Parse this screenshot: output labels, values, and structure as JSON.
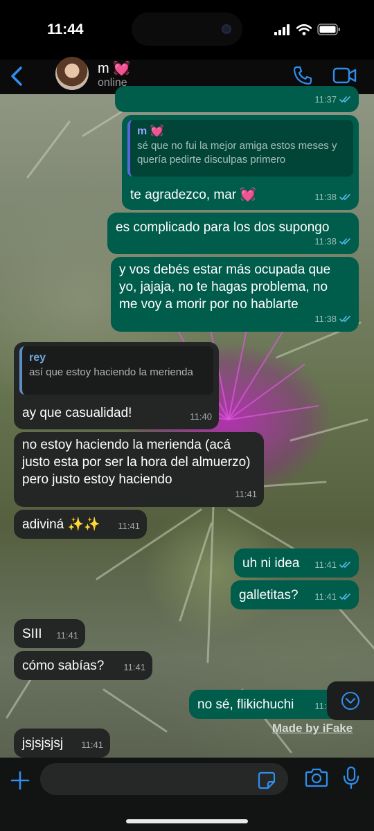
{
  "status_bar": {
    "time": "11:44"
  },
  "header": {
    "contact_name": "m 💓",
    "contact_status": "online"
  },
  "messages": [
    {
      "id": "m0",
      "direction": "out",
      "text": "",
      "time": "11:37",
      "read": true
    },
    {
      "id": "m1",
      "direction": "out",
      "reply_author": "m 💓",
      "reply_text": "sé que no fui la mejor amiga estos meses y quería pedirte disculpas primero",
      "text": "te agradezco, mar 💓",
      "time": "11:38",
      "read": true
    },
    {
      "id": "m2",
      "direction": "out",
      "text": "es complicado para los dos supongo",
      "time": "11:38",
      "read": true
    },
    {
      "id": "m3",
      "direction": "out",
      "text": "y vos debés estar más ocupada que yo, jajaja, no te hagas problema, no me voy a morir por no hablarte",
      "time": "11:38",
      "read": true
    },
    {
      "id": "m4",
      "direction": "in",
      "reply_author": "rey",
      "reply_text": "así que estoy haciendo la merienda",
      "text": "ay que casualidad!",
      "time": "11:40"
    },
    {
      "id": "m5",
      "direction": "in",
      "text": "no estoy haciendo la merienda (acá justo esta por ser la hora del almuerzo) pero justo estoy haciendo",
      "time": "11:41"
    },
    {
      "id": "m6",
      "direction": "in",
      "text": "adiviná ✨✨",
      "time": "11:41"
    },
    {
      "id": "m7",
      "direction": "out",
      "text": "uh ni idea",
      "time": "11:41",
      "read": true
    },
    {
      "id": "m8",
      "direction": "out",
      "text": "galletitas?",
      "time": "11:41",
      "read": true
    },
    {
      "id": "m9",
      "direction": "in",
      "text": "SIII",
      "time": "11:41"
    },
    {
      "id": "m10",
      "direction": "in",
      "text": "cómo sabías?",
      "time": "11:41"
    },
    {
      "id": "m11",
      "direction": "out",
      "text": "no sé, flikichuchi",
      "time": "11:41",
      "read": true
    },
    {
      "id": "m12",
      "direction": "in",
      "text": "jsjsjsjsj",
      "time": "11:41"
    }
  ],
  "watermark": "Made by iFake",
  "composer": {
    "placeholder": ""
  },
  "colors": {
    "outgoing_bubble": "#005c4b",
    "incoming_bubble": "#242626",
    "accent": "#2f8ff0",
    "read_ticks": "#53bdeb"
  },
  "icons": [
    "back-chevron-icon",
    "voice-call-icon",
    "video-call-icon",
    "scroll-down-icon",
    "plus-icon",
    "sticker-icon",
    "camera-icon",
    "microphone-icon"
  ]
}
